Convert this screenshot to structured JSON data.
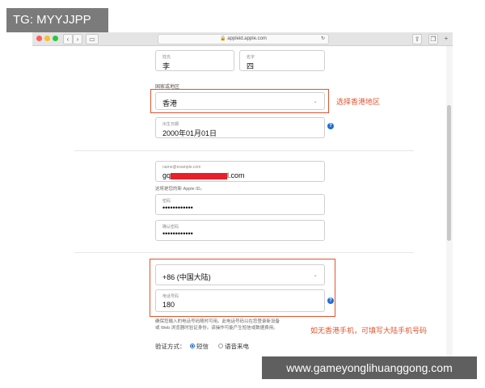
{
  "watermark": {
    "tag": "TG: MYYJJPP",
    "site": "www.gameyonglihuanggong.com"
  },
  "browser": {
    "url": "appleid.apple.com",
    "back": "‹",
    "forward": "›"
  },
  "form": {
    "last_name": {
      "label": "姓氏",
      "value": "李"
    },
    "first_name": {
      "label": "名字",
      "value": "四"
    },
    "region": {
      "label": "国家或地区",
      "value": "香港"
    },
    "birthday": {
      "label": "出生日期",
      "value": "2000年01月01日"
    },
    "email": {
      "placeholder": "name@example.com",
      "value_prefix": "gq",
      "value_suffix": "l.com"
    },
    "email_note": "这将是您的新 Apple ID。",
    "password": {
      "label": "密码",
      "value": "••••••••••••"
    },
    "confirm_password": {
      "label": "确认密码",
      "value": "••••••••••••"
    },
    "country_code": {
      "value": "+86 (中国大陆)"
    },
    "phone": {
      "label": "电话号码",
      "value": "180"
    },
    "phone_note_1": "确保您输入的电话号码随时可用。此电话号码以在您登录新设备",
    "phone_note_2": "或 Web 浏览器时验证身份。该操作可能产生短信或数据费用。",
    "verify": {
      "label": "验证方式：",
      "sms": "短信",
      "voice": "语音来电"
    }
  },
  "annotations": {
    "select_region": "选择香港地区",
    "phone_hint": "如无香港手机，可填写大陆手机号码"
  },
  "colors": {
    "annotation": "#e0552f",
    "info": "#1f6fd1"
  }
}
